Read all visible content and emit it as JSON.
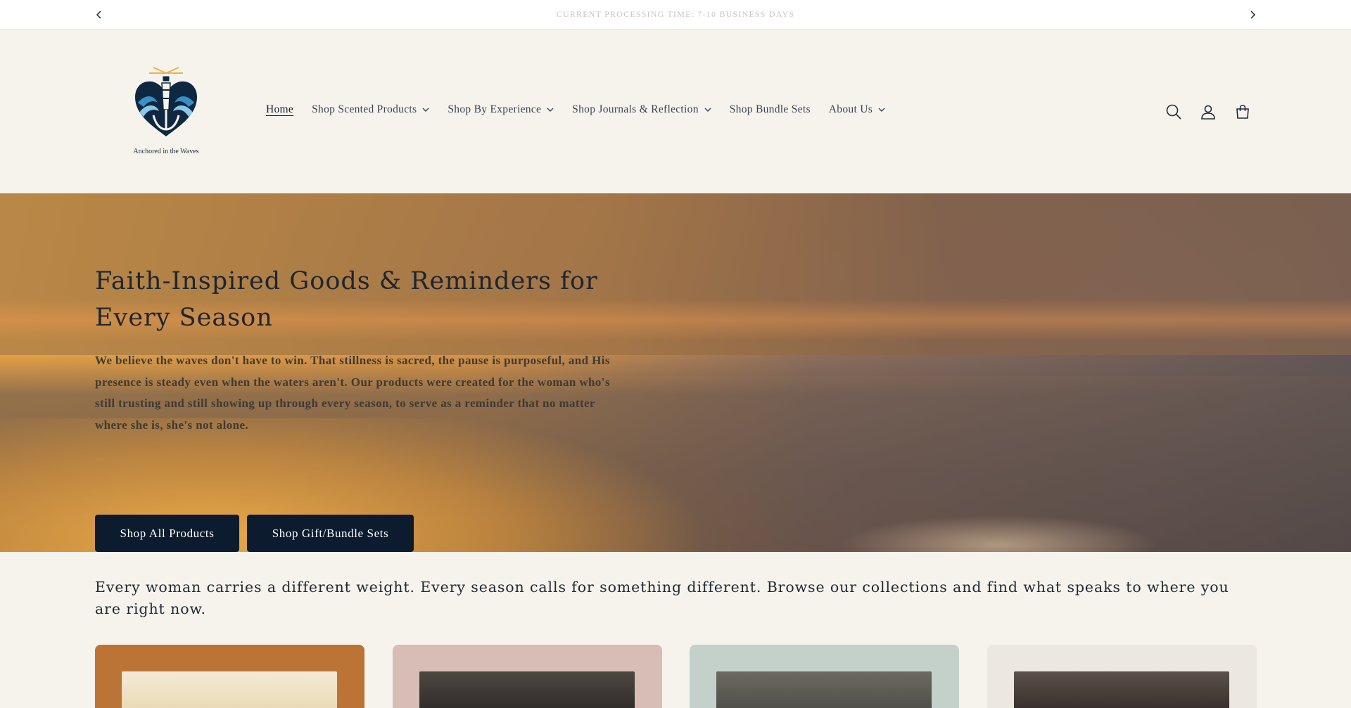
{
  "announcement": {
    "text": "CURRENT PROCESSING TIME: 7-10 BUSINESS DAYS",
    "prev_icon": "chevron-left-icon",
    "next_icon": "chevron-right-icon"
  },
  "brand": {
    "logo_text": "Anchored in the Waves",
    "logo_icon": "lighthouse-anchor-heart-logo",
    "colors": {
      "navy": "#0c1b2e",
      "wave_blue": "#3b8fc7"
    }
  },
  "nav": {
    "items": [
      {
        "label": "Home",
        "active": true,
        "dropdown": false
      },
      {
        "label": "Shop Scented Products",
        "active": false,
        "dropdown": true
      },
      {
        "label": "Shop By Experience",
        "active": false,
        "dropdown": true
      },
      {
        "label": "Shop Journals & Reflection",
        "active": false,
        "dropdown": true
      },
      {
        "label": "Shop Bundle Sets",
        "active": false,
        "dropdown": false
      },
      {
        "label": "About Us",
        "active": false,
        "dropdown": true
      }
    ]
  },
  "header_icons": [
    "search-icon",
    "account-icon",
    "cart-icon"
  ],
  "hero": {
    "title": "Faith-Inspired Goods & Reminders for Every Season",
    "body": "We believe the waves don't have to win. That stillness is sacred, the pause is purposeful, and His presence is steady even when the waters aren't. Our products were created for the woman who's still trusting and still showing up through every season, to serve as a reminder that no matter where she is, she's not alone.",
    "primary_button": "Shop All Products",
    "secondary_button": "Shop Gift/Bundle Sets"
  },
  "intro": {
    "text": "Every woman carries a different weight. Every season calls for something different. Browse our collections and find what speaks to where you are right now."
  },
  "collection_cards": [
    {
      "background": "#bb7436"
    },
    {
      "background": "#d8bcb6"
    },
    {
      "background": "#c4d1cb"
    },
    {
      "background": "#ece7e1"
    }
  ]
}
